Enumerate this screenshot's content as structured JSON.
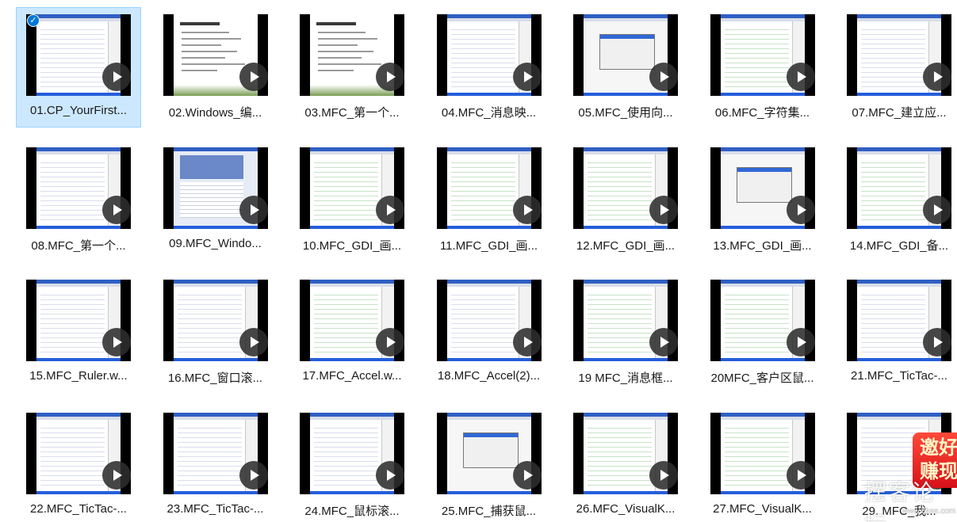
{
  "files": [
    {
      "label": "01.CP_YourFirst...",
      "thumb": "code",
      "selected": true
    },
    {
      "label": "02.Windows_编...",
      "thumb": "slide"
    },
    {
      "label": "03.MFC_第一个...",
      "thumb": "slide"
    },
    {
      "label": "04.MFC_消息映...",
      "thumb": "code"
    },
    {
      "label": "05.MFC_使用向...",
      "thumb": "dialog"
    },
    {
      "label": "06.MFC_字符集...",
      "thumb": "code-green"
    },
    {
      "label": "07.MFC_建立应...",
      "thumb": "code"
    },
    {
      "label": "08.MFC_第一个...",
      "thumb": "code"
    },
    {
      "label": "09.MFC_Windo...",
      "thumb": "web"
    },
    {
      "label": "10.MFC_GDI_画...",
      "thumb": "code-green"
    },
    {
      "label": "11.MFC_GDI_画...",
      "thumb": "code-green"
    },
    {
      "label": "12.MFC_GDI_画...",
      "thumb": "code-green"
    },
    {
      "label": "13.MFC_GDI_画...",
      "thumb": "dialog"
    },
    {
      "label": "14.MFC_GDI_备...",
      "thumb": "code-green"
    },
    {
      "label": "15.MFC_Ruler.w...",
      "thumb": "code"
    },
    {
      "label": "16.MFC_窗口滚...",
      "thumb": "code"
    },
    {
      "label": "17.MFC_Accel.w...",
      "thumb": "code-green"
    },
    {
      "label": "18.MFC_Accel(2)...",
      "thumb": "code"
    },
    {
      "label": "19 MFC_消息框...",
      "thumb": "code-green"
    },
    {
      "label": "20MFC_客户区鼠...",
      "thumb": "code-green"
    },
    {
      "label": "21.MFC_TicTac-...",
      "thumb": "code"
    },
    {
      "label": "22.MFC_TicTac-...",
      "thumb": "code"
    },
    {
      "label": "23.MFC_TicTac-...",
      "thumb": "code"
    },
    {
      "label": "24.MFC_鼠标滚...",
      "thumb": "code"
    },
    {
      "label": "25.MFC_捕获鼠...",
      "thumb": "dialog"
    },
    {
      "label": "26.MFC_VisualK...",
      "thumb": "code-green"
    },
    {
      "label": "27.MFC_VisualK...",
      "thumb": "code-green"
    },
    {
      "label": "29. MFC_我...",
      "thumb": "code"
    }
  ],
  "icons": {
    "play": "play-icon",
    "check": "checkmark-icon"
  },
  "colors": {
    "selection_bg": "#cce8ff",
    "selection_border": "#99d1ff",
    "accent": "#0078d7"
  },
  "overlay": {
    "badge_text": "邀好赚现",
    "watermark_text": "摆客论坛",
    "watermark_url": "www.bkee.com"
  }
}
